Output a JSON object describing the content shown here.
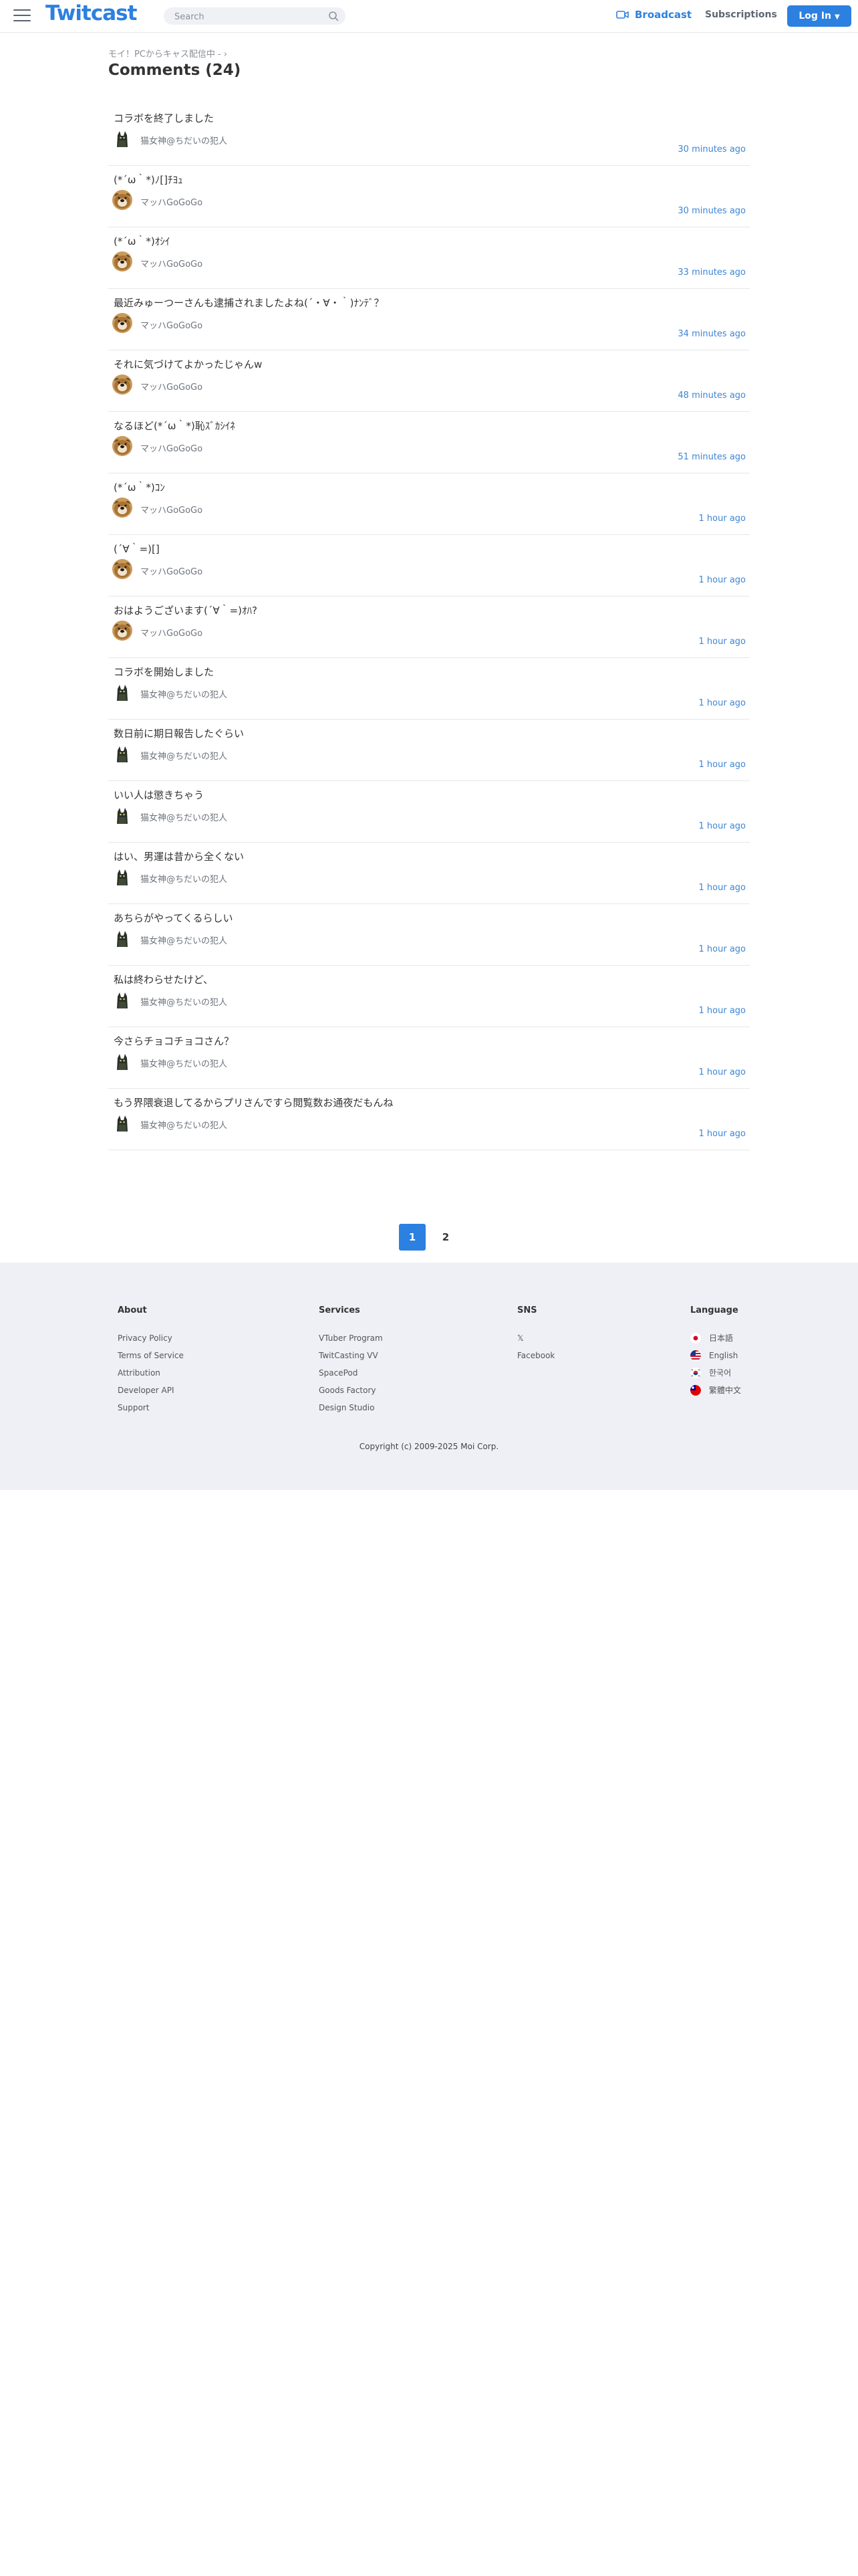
{
  "header": {
    "logo": "Twitcast",
    "search_placeholder": "Search",
    "broadcast_label": "Broadcast",
    "subscriptions_label": "Subscriptions",
    "login_label": "Log In",
    "accent_color": "#2c80e0"
  },
  "breadcrumb": {
    "text": "モイ！PCからキャス配信中 -",
    "chevron": "›"
  },
  "page": {
    "title": "Comments (24)"
  },
  "comments": [
    {
      "text": "コラボを終了しました",
      "author": "猫女神@ちだいの犯人",
      "time": "30 minutes ago",
      "avatar": "cat-avatar"
    },
    {
      "text": "(*´ω｀*)ﾉ[]ﾁﾖｭ",
      "author": "マッハGoGoGo",
      "time": "30 minutes ago",
      "avatar": "dog-avatar"
    },
    {
      "text": "(*´ω｀*)ｵｼｲ",
      "author": "マッハGoGoGo",
      "time": "33 minutes ago",
      "avatar": "dog-avatar"
    },
    {
      "text": "最近みゅーつーさんも逮捕されましたよね(´・∀・｀)ﾅﾝﾃﾞ？",
      "author": "マッハGoGoGo",
      "time": "34 minutes ago",
      "avatar": "dog-avatar"
    },
    {
      "text": "それに気づけてよかったじゃんw",
      "author": "マッハGoGoGo",
      "time": "48 minutes ago",
      "avatar": "dog-avatar"
    },
    {
      "text": "なるほど(*´ω｀*)恥ｽﾞｶｼｲﾈ",
      "author": "マッハGoGoGo",
      "time": "51 minutes ago",
      "avatar": "dog-avatar"
    },
    {
      "text": "(*´ω｀*)ｺﾝ",
      "author": "マッハGoGoGo",
      "time": "1 hour ago",
      "avatar": "dog-avatar"
    },
    {
      "text": "(´∀｀=)[]",
      "author": "マッハGoGoGo",
      "time": "1 hour ago",
      "avatar": "dog-avatar"
    },
    {
      "text": "おはようございます(´∀｀=)ｵﾊ?",
      "author": "マッハGoGoGo",
      "time": "1 hour ago",
      "avatar": "dog-avatar"
    },
    {
      "text": "コラボを開始しました",
      "author": "猫女神@ちだいの犯人",
      "time": "1 hour ago",
      "avatar": "cat-avatar"
    },
    {
      "text": "数日前に期日報告したぐらい",
      "author": "猫女神@ちだいの犯人",
      "time": "1 hour ago",
      "avatar": "cat-avatar"
    },
    {
      "text": "いい人は懲きちゃう",
      "author": "猫女神@ちだいの犯人",
      "time": "1 hour ago",
      "avatar": "cat-avatar"
    },
    {
      "text": "はい、男運は昔から全くない",
      "author": "猫女神@ちだいの犯人",
      "time": "1 hour ago",
      "avatar": "cat-avatar"
    },
    {
      "text": "あちらがやってくるらしい",
      "author": "猫女神@ちだいの犯人",
      "time": "1 hour ago",
      "avatar": "cat-avatar"
    },
    {
      "text": "私は終わらせたけど、",
      "author": "猫女神@ちだいの犯人",
      "time": "1 hour ago",
      "avatar": "cat-avatar"
    },
    {
      "text": "今さらチョコチョコさん？",
      "author": "猫女神@ちだいの犯人",
      "time": "1 hour ago",
      "avatar": "cat-avatar"
    },
    {
      "text": "もう界隈衰退してるからプリさんですら閲覧数お通夜だもんね",
      "author": "猫女神@ちだいの犯人",
      "time": "1 hour ago",
      "avatar": "cat-avatar"
    }
  ],
  "pagination": {
    "pages": [
      "1",
      "2"
    ],
    "current": "1"
  },
  "footer": {
    "about": {
      "heading": "About",
      "links": [
        "Privacy Policy",
        "Terms of Service",
        "Attribution",
        "Developer API",
        "Support"
      ]
    },
    "services": {
      "heading": "Services",
      "links": [
        "VTuber Program",
        "TwitCasting VV",
        "SpacePod",
        "Goods Factory",
        "Design Studio"
      ]
    },
    "sns": {
      "heading": "SNS",
      "links": [
        "𝕏",
        "Facebook"
      ]
    },
    "language": {
      "heading": "Language",
      "links": [
        {
          "label": "日本語",
          "flag": "flag-japan-icon"
        },
        {
          "label": "English",
          "flag": "flag-us-icon"
        },
        {
          "label": "한국어",
          "flag": "flag-korea-icon"
        },
        {
          "label": "繁體中文",
          "flag": "flag-taiwan-icon"
        }
      ]
    },
    "copyright": "Copyright (c) 2009-2025 Moi Corp."
  }
}
